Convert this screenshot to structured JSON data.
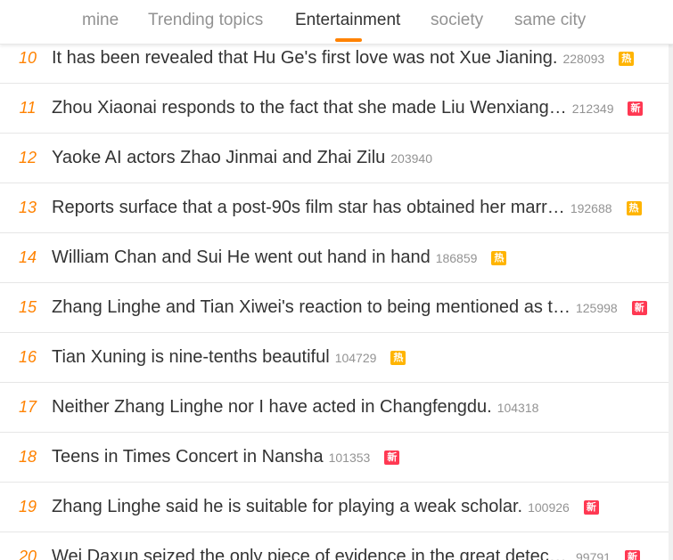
{
  "tabs": [
    {
      "label": "mine"
    },
    {
      "label": "Trending topics"
    },
    {
      "label": "Entertainment",
      "active": true
    },
    {
      "label": "society"
    },
    {
      "label": "same city"
    }
  ],
  "badges": {
    "hot": "热",
    "new": "新"
  },
  "colors": {
    "accent": "#ff8200",
    "hot_badge": "#ffb400",
    "new_badge": "#ff3852"
  },
  "items": [
    {
      "rank": "10",
      "title": "It has been revealed that Hu Ge's first love was not Xue Jianing.",
      "count": "228093",
      "badge": "hot"
    },
    {
      "rank": "11",
      "title": "Zhou Xiaonai responds to the fact that she made Liu Wenxiang…",
      "count": "212349",
      "badge": "new"
    },
    {
      "rank": "12",
      "title": "Yaoke AI actors Zhao Jinmai and Zhai Zilu",
      "count": "203940",
      "badge": ""
    },
    {
      "rank": "13",
      "title": "Reports surface that a post-90s film star has obtained her marr…",
      "count": "192688",
      "badge": "hot"
    },
    {
      "rank": "14",
      "title": "William Chan and Sui He went out hand in hand",
      "count": "186859",
      "badge": "hot"
    },
    {
      "rank": "15",
      "title": "Zhang Linghe and Tian Xiwei's reaction to being mentioned as t…",
      "count": "125998",
      "badge": "new"
    },
    {
      "rank": "16",
      "title": "Tian Xuning is nine-tenths beautiful",
      "count": "104729",
      "badge": "hot"
    },
    {
      "rank": "17",
      "title": "Neither Zhang Linghe nor I have acted in Changfengdu.",
      "count": "104318",
      "badge": ""
    },
    {
      "rank": "18",
      "title": "Teens in Times Concert in Nansha",
      "count": "101353",
      "badge": "new"
    },
    {
      "rank": "19",
      "title": "Zhang Linghe said he is suitable for playing a weak scholar.",
      "count": "100926",
      "badge": "new"
    },
    {
      "rank": "20",
      "title": "Wei Daxun seized the only piece of evidence in the great detecti…",
      "count": "99791",
      "badge": "new"
    }
  ]
}
